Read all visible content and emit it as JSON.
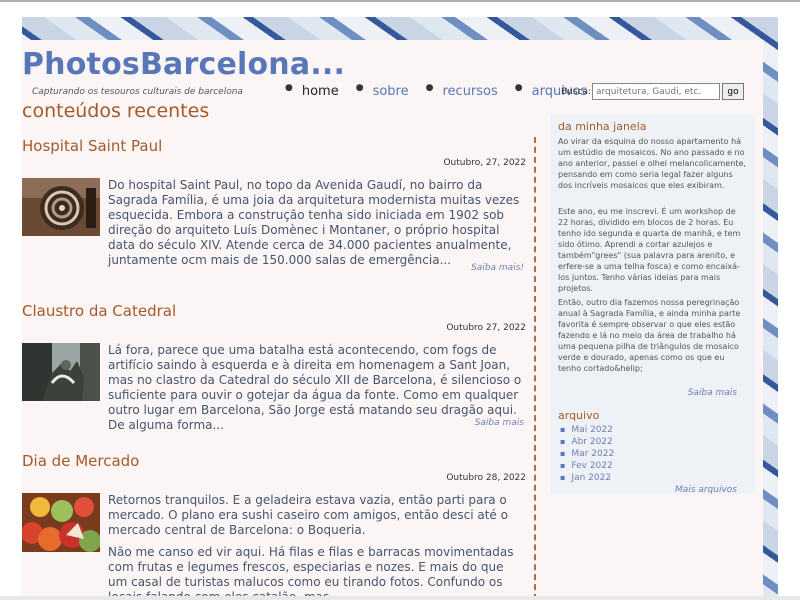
{
  "site": {
    "title": "PhotosBarcelona...",
    "tagline": "Capturando os tesouros culturais de barcelona"
  },
  "nav": [
    {
      "label": "home",
      "active": true
    },
    {
      "label": "sobre",
      "active": false
    },
    {
      "label": "recursos",
      "active": false
    },
    {
      "label": "arquivos",
      "active": false
    }
  ],
  "search": {
    "label": "Busca:",
    "placeholder": "arquitetura, Gaudi, etc.",
    "button": "go"
  },
  "section_title": "conteúdos recentes",
  "posts": [
    {
      "title": "Hospital Saint Paul",
      "date": "Outubro, 27, 2022",
      "thumb_icon": "sculpture-photo",
      "paragraphs": [
        "Do hospital Saint Paul, no topo da Avenida Gaudí, no bairro da Sagrada Família, é uma joia da arquitetura modernista muitas vezes esquecida. Embora a construção tenha sido iniciada em 1902 sob direção do arquiteto Luís Domènec i Montaner, o próprio hospital data do século XIV. Atende cerca de 34.000 pacientes anualmente, juntamente ocm mais de 150.000 salas de emergência..."
      ],
      "more": "Saiba mais!"
    },
    {
      "title": "Claustro da Catedral",
      "date": "Outubro 27, 2022",
      "thumb_icon": "fountain-photo",
      "paragraphs": [
        "Lá fora, parece que uma batalha está acontecendo, com fogs de artifício saindo à esquerda e à direita em homenagem a Sant Joan, mas no clastro da Catedral do século XII de Barcelona, é silencioso o suficiente para ouvir o gotejar da água da fonte. Como em qualquer outro lugar em Barcelona, São Jorge está matando seu dragão aqui. De alguma forma..."
      ],
      "more": "Saiba mais"
    },
    {
      "title": "Dia de Mercado",
      "date": "Outubro 28, 2022",
      "thumb_icon": "fruit-market-photo",
      "paragraphs": [
        "Retornos tranquilos. E a geladeira estava vazia, então parti para o mercado. O plano era sushi caseiro com amigos, então desci até o mercado central de Barcelona: o Boqueria.",
        "Não me canso ed vir aqui. Há filas e filas e barracas movimentadas com frutas e legumes frescos, especiarias e nozes. E mais do que um casal de turistas malucos como eu tirando fotos. Confundo os locais falando com eles catalão, mas..."
      ],
      "more": ""
    }
  ],
  "sidebar": {
    "window_title": "da minha janela",
    "window_paragraphs": [
      "Ao virar da esquina do nosso apartamento há um estúdio de mosaicos. No ano passado e no ano anterior, passei e olhei melancolicamente, pensando em como seria legal fazer alguns dos incríveis mosaicos que eles exibiram.",
      "Este ano, eu me inscrevi. É um workshop de 22 horas, dividido em blocos de 2 horas. Eu tenho ido segunda e quarta de manhã, e tem sido ótimo. Aprendi a cortar azulejos e também\"grees\" (sua palavra para arenito, e erfere-se a uma telha fosca) e como encaixá-los juntos. Tenho várias ideias para mais projetos.",
      "Então, outro dia fazemos nossa peregrinação anual à Sagrada Família, e ainda minha parte favorita é sempre observar o que eles estão fazendo e lá no meio da área de trabalho há uma pequena pilha de triângulos de mosaico verde e dourado, apenas como os que eu tenho cortado&helip;"
    ],
    "window_more": "Saiba mais",
    "archive_title": "arquivo",
    "archive_items": [
      "Mai 2022",
      "Abr 2022",
      "Mar 2022",
      "Fev 2022",
      "Jan 2022"
    ],
    "archive_more": "Mais arquivos"
  },
  "colors": {
    "accent_blue": "#5877b8",
    "heading_orange": "#a45a28",
    "page_bg": "#fcf5f5",
    "sidebar_bg": "#eef1f6"
  }
}
